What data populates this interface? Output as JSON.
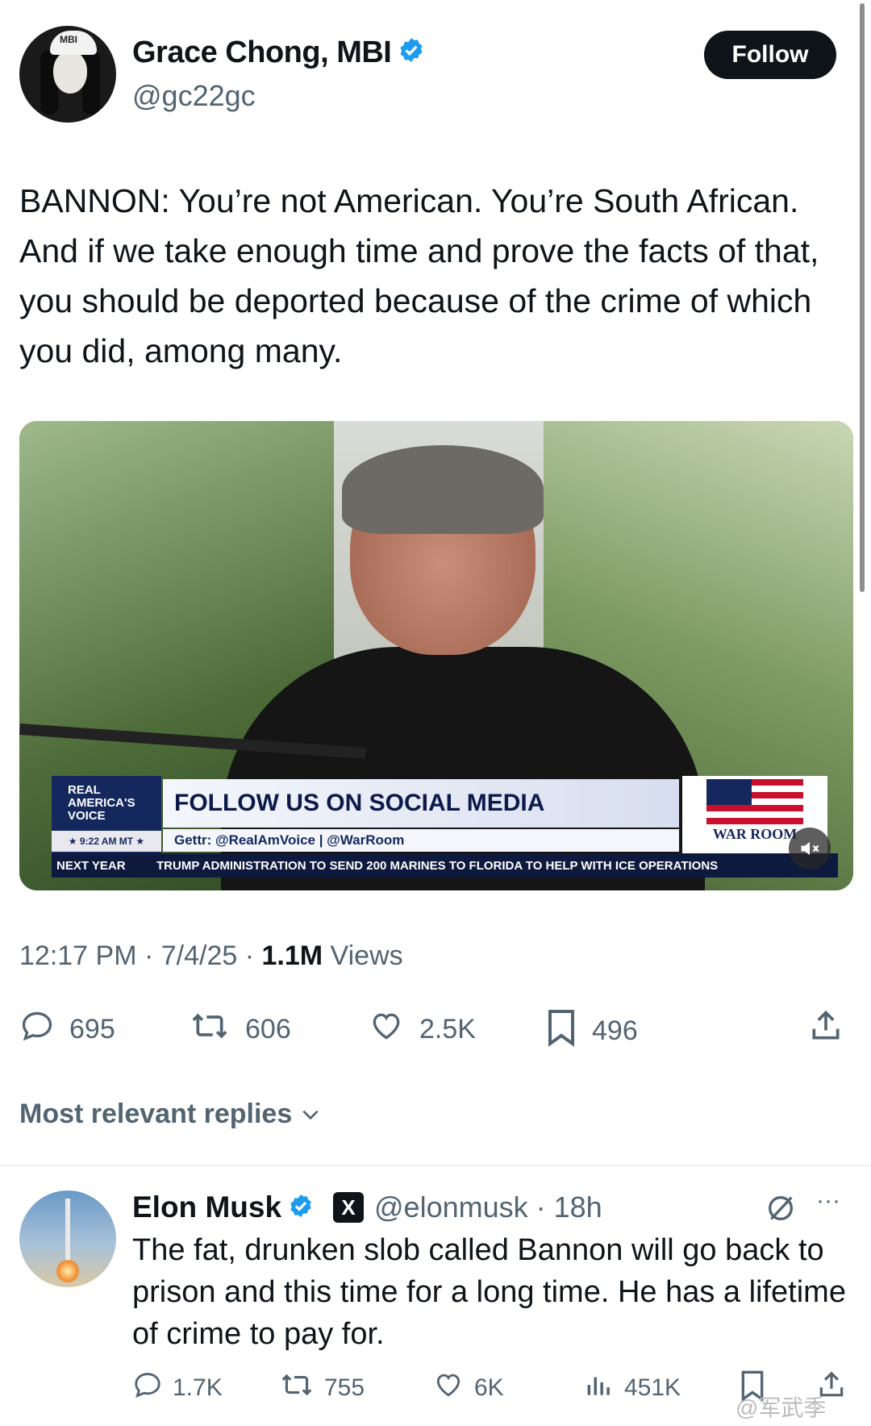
{
  "tweet": {
    "author": {
      "display_name": "Grace Chong, MBI",
      "handle": "@gc22gc",
      "avatar_cap_text": "MBI"
    },
    "follow_label": "Follow",
    "text": "BANNON: You’re not American. You’re South African. And if we take enough time and prove the facts of that, you should be deported because of the crime of which you did, among many.",
    "media": {
      "logo_line1": "REAL",
      "logo_line2": "AMERICA'S",
      "logo_line3": "VOICE",
      "time": "★ 9:22 AM MT ★",
      "banner": "FOLLOW US ON SOCIAL MEDIA",
      "sub": "Gettr: @RealAmVoice | @WarRoom",
      "war_room": "WAR ROOM",
      "ticker_label": "NEXT YEAR",
      "ticker_text": "TRUMP ADMINISTRATION TO SEND 200 MARINES TO FLORIDA TO HELP WITH ICE OPERATIONS"
    },
    "time": "12:17 PM · 7/4/25 · ",
    "views_count": "1.1M",
    "views_label": " Views",
    "stats": {
      "replies": "695",
      "reposts": "606",
      "likes": "2.5K",
      "bookmarks": "496"
    }
  },
  "replies_header": "Most relevant replies",
  "reply": {
    "display_name": "Elon Musk",
    "x_badge": "X",
    "handle_time": "@elonmusk · 18h",
    "more": "···",
    "text": "The fat, drunken slob called Bannon will go back to prison and this time for a long time. He has a lifetime of crime to pay for.",
    "stats": {
      "replies": "1.7K",
      "reposts": "755",
      "likes": "6K",
      "views": "451K"
    }
  },
  "watermark": "@军武季",
  "colors": {
    "verified_blue": "#1d9bf0",
    "text_secondary": "#536471",
    "text_primary": "#0f1419"
  }
}
